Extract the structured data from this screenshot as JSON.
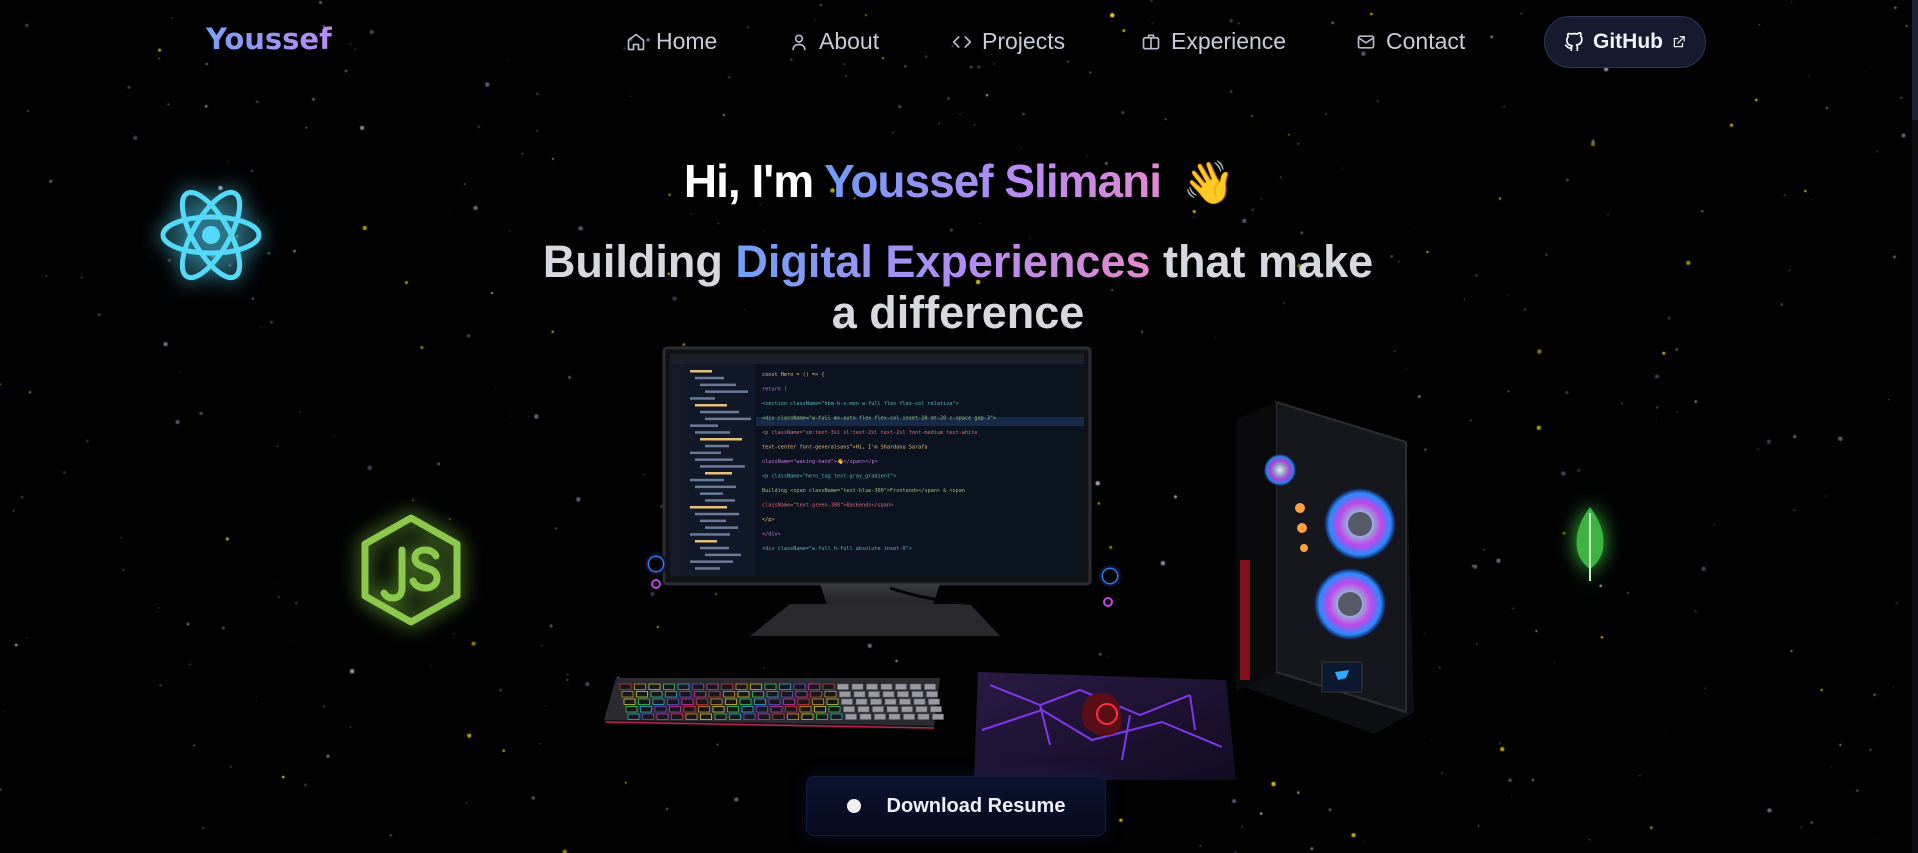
{
  "nav": {
    "logo": "Youssef",
    "items": [
      {
        "label": "Home",
        "icon": "home-icon"
      },
      {
        "label": "About",
        "icon": "user-icon"
      },
      {
        "label": "Projects",
        "icon": "code-icon"
      },
      {
        "label": "Experience",
        "icon": "briefcase-icon"
      },
      {
        "label": "Contact",
        "icon": "mail-icon"
      }
    ],
    "github": {
      "label": "GitHub",
      "icon": "github-icon",
      "trailing_icon": "external-link-icon"
    }
  },
  "hero": {
    "greeting_prefix": "Hi, I'm",
    "name": "Youssef Slimani",
    "wave": "👋",
    "tagline_start": "Building",
    "tagline_highlight": "Digital Experiences",
    "tagline_end": "that make a difference"
  },
  "tech_icons": [
    "react-icon",
    "nodejs-icon",
    "mongodb-leaf-icon"
  ],
  "scene": {
    "description_icon": "desk-setup-3d-icon",
    "code_lines": [
      "const Hero = () => {",
      "  return (",
      "    <section className=\"hbm-b-s-mon w-full flex flex-col relative\">",
      "      <div className=\"w-full mx-auto flex flex-col inset-10 mt-20 c-space gap-3\">",
      "        <p className=\"sm:text-3xl xl:text-2xl text-2xl font-medium text-white",
      "          text-center font-generalsans\">Hi, I'm Shardanu Sarafa",
      "          className=\"waving-hand\">👋</span></p>",
      "        <p className=\"hero_tag text-gray_gradient\">",
      "          Building <span className=\"text-blue-300\">Frontends</span> & <span",
      "          className=\"text-green-300\">Backends</span>",
      "        </p>",
      "      </div>",
      "      <div className=\"w-full h-full absolute inset-0\">"
    ]
  },
  "download": {
    "label": "Download Resume"
  },
  "colors": {
    "background": "#020203",
    "accent_blue": "#6f9bf6",
    "accent_purple": "#b98af2",
    "accent_pink": "#e08ad0"
  }
}
